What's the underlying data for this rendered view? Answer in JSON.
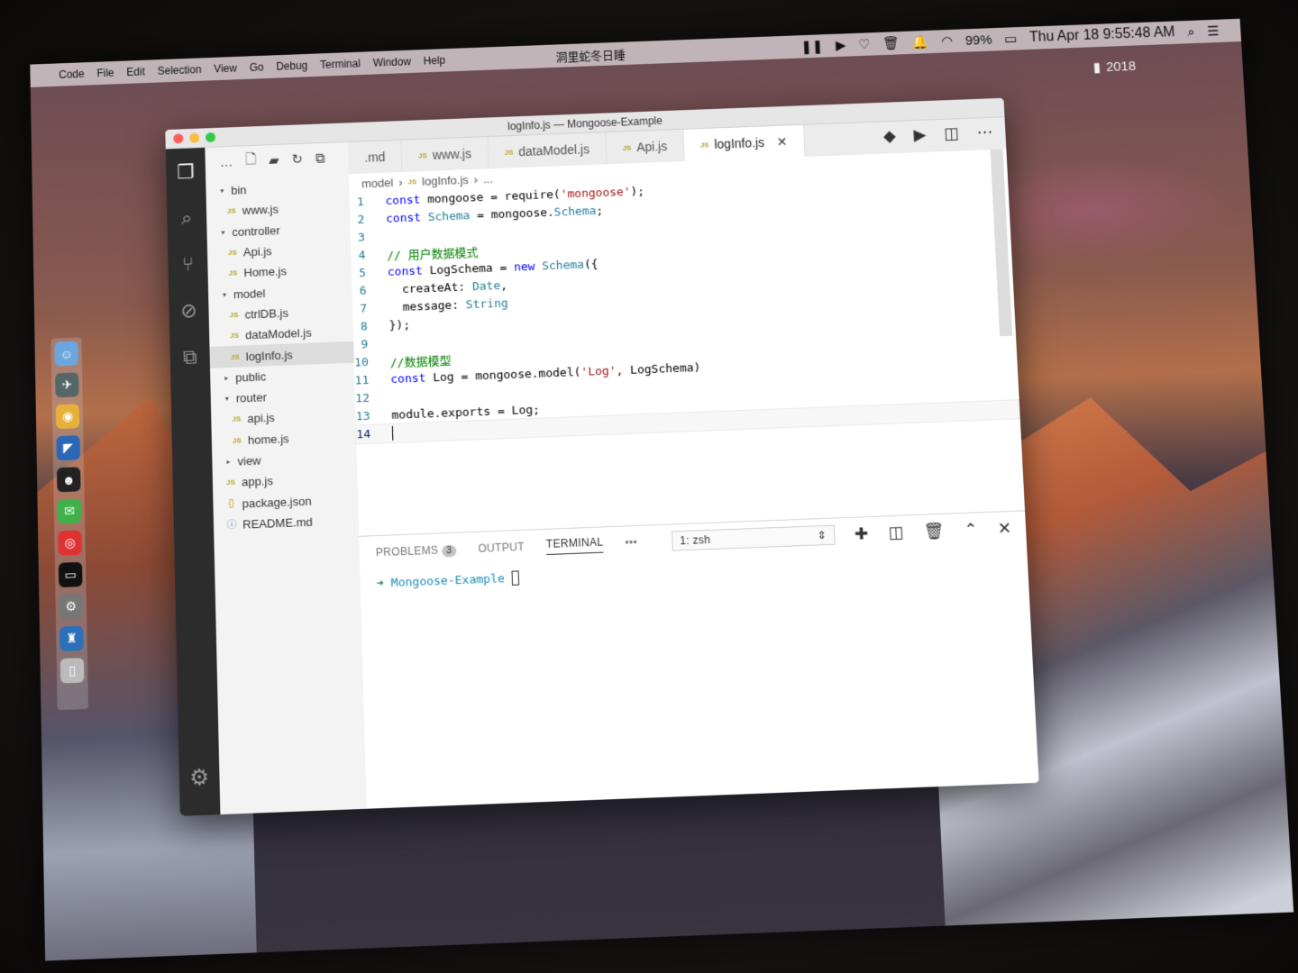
{
  "menubar": {
    "apple": "",
    "items": [
      "Code",
      "File",
      "Edit",
      "Selection",
      "View",
      "Go",
      "Debug",
      "Terminal",
      "Window",
      "Help"
    ],
    "center_text": "洞里蛇冬日睡",
    "battery": "99%",
    "clock": "Thu Apr 18  9:55:48 AM"
  },
  "desktop": {
    "year_label": "2018"
  },
  "window": {
    "title": "logInfo.js — Mongoose-Example",
    "traffic_colors": [
      "#fc605c",
      "#fdbc40",
      "#34c84a"
    ]
  },
  "sidebar": {
    "tree": [
      {
        "kind": "folder",
        "label": "bin",
        "open": true,
        "depth": 0
      },
      {
        "kind": "js",
        "label": "www.js",
        "depth": 1
      },
      {
        "kind": "folder",
        "label": "controller",
        "open": true,
        "depth": 0
      },
      {
        "kind": "js",
        "label": "Api.js",
        "depth": 1
      },
      {
        "kind": "js",
        "label": "Home.js",
        "depth": 1
      },
      {
        "kind": "folder",
        "label": "model",
        "open": true,
        "depth": 0
      },
      {
        "kind": "js",
        "label": "ctrlDB.js",
        "depth": 1
      },
      {
        "kind": "js",
        "label": "dataModel.js",
        "depth": 1
      },
      {
        "kind": "js",
        "label": "logInfo.js",
        "depth": 1,
        "selected": true
      },
      {
        "kind": "folder",
        "label": "public",
        "open": false,
        "depth": 0
      },
      {
        "kind": "folder",
        "label": "router",
        "open": true,
        "depth": 0
      },
      {
        "kind": "js",
        "label": "api.js",
        "depth": 1
      },
      {
        "kind": "js",
        "label": "home.js",
        "depth": 1
      },
      {
        "kind": "folder",
        "label": "view",
        "open": false,
        "depth": 0
      },
      {
        "kind": "js",
        "label": "app.js",
        "depth": 0
      },
      {
        "kind": "json",
        "label": "package.json",
        "depth": 0
      },
      {
        "kind": "info",
        "label": "README.md",
        "depth": 0
      }
    ]
  },
  "tabs": [
    {
      "label": ".md",
      "js": false,
      "active": false
    },
    {
      "label": "www.js",
      "js": true,
      "active": false
    },
    {
      "label": "dataModel.js",
      "js": true,
      "active": false
    },
    {
      "label": "Api.js",
      "js": true,
      "active": false
    },
    {
      "label": "logInfo.js",
      "js": true,
      "active": true
    }
  ],
  "breadcrumb": {
    "folder": "model",
    "file": "logInfo.js",
    "more": "..."
  },
  "code": [
    "const mongoose = require('mongoose');",
    "const Schema = mongoose.Schema;",
    "",
    "// 用户数据模式",
    "const LogSchema = new Schema({",
    "  createAt: Date,",
    "  message: String",
    "});",
    "",
    "//数据模型",
    "const Log = mongoose.model('Log', LogSchema)",
    "",
    "module.exports = Log;",
    ""
  ],
  "current_line": 14,
  "panel": {
    "tabs": [
      "PROBLEMS",
      "OUTPUT",
      "TERMINAL"
    ],
    "problems_count": "3",
    "more": "•••",
    "terminal_select": "1: zsh",
    "prompt_arrow": "➜",
    "prompt_dir": "Mongoose-Example"
  }
}
